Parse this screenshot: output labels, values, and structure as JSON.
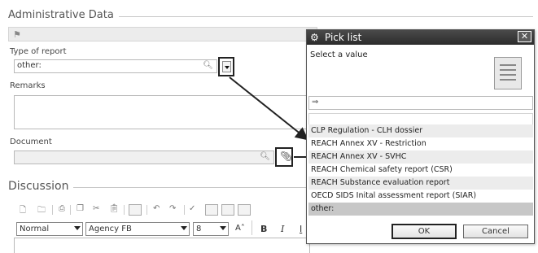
{
  "admin": {
    "title": "Administrative Data",
    "type_label": "Type of report",
    "type_value": "other:",
    "remarks_label": "Remarks",
    "document_label": "Document"
  },
  "discussion": {
    "title": "Discussion",
    "style_value": "Normal",
    "font_value": "Agency FB",
    "size_value": "8",
    "bold": "B",
    "italic": "I",
    "underline": "I"
  },
  "picklist": {
    "title": "Pick list",
    "prompt": "Select a value",
    "items": [
      "CLP Regulation - CLH dossier",
      "REACH Annex XV - Restriction",
      "REACH Annex XV - SVHC",
      "REACH Chemical safety report (CSR)",
      "REACH Substance evaluation report",
      "OECD SIDS Inital assessment report (SIAR)",
      "other:"
    ],
    "ok_label": "OK",
    "cancel_label": "Cancel",
    "close_icon": "close-icon",
    "filter_icon": "filter-icon"
  }
}
